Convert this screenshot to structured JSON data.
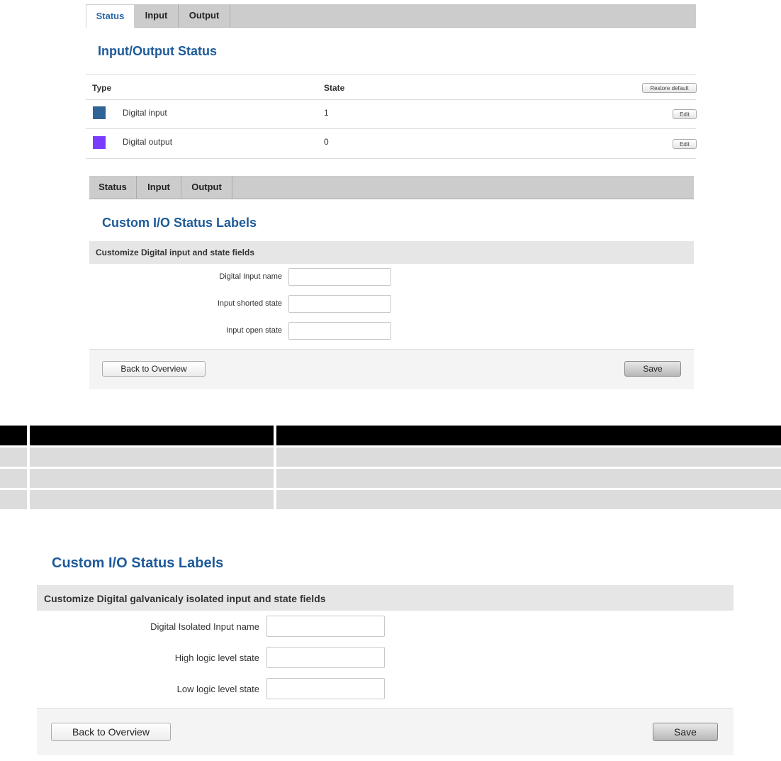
{
  "status_panel": {
    "tabs": [
      "Status",
      "Input",
      "Output"
    ],
    "active_tab": "Status",
    "title": "Input/Output Status",
    "columns": {
      "type": "Type",
      "state": "State"
    },
    "restore_label": "Restore default",
    "rows": [
      {
        "name": "Digital input",
        "state": "1",
        "color": "#2f6496",
        "edit_label": "Edit"
      },
      {
        "name": "Digital output",
        "state": "0",
        "color": "#7a3cff",
        "edit_label": "Edit"
      }
    ]
  },
  "input_panel": {
    "tabs": [
      "Status",
      "Input",
      "Output"
    ],
    "title": "Custom I/O Status Labels",
    "section_title": "Customize Digital input and state fields",
    "fields": [
      {
        "label": "Digital Input name",
        "value": ""
      },
      {
        "label": "Input shorted state",
        "value": ""
      },
      {
        "label": "Input open state",
        "value": ""
      }
    ],
    "back_label": "Back to Overview",
    "save_label": "Save"
  },
  "middle_table": {
    "header_color": "#000000",
    "row_color": "#dcdcdc",
    "row_count": 3
  },
  "isolated_panel": {
    "title": "Custom I/O Status Labels",
    "section_title": "Customize Digital galvanicaly isolated input and state fields",
    "fields": [
      {
        "label": "Digital Isolated Input name",
        "value": ""
      },
      {
        "label": "High logic level state",
        "value": ""
      },
      {
        "label": "Low logic level state",
        "value": ""
      }
    ],
    "back_label": "Back to Overview",
    "save_label": "Save"
  }
}
